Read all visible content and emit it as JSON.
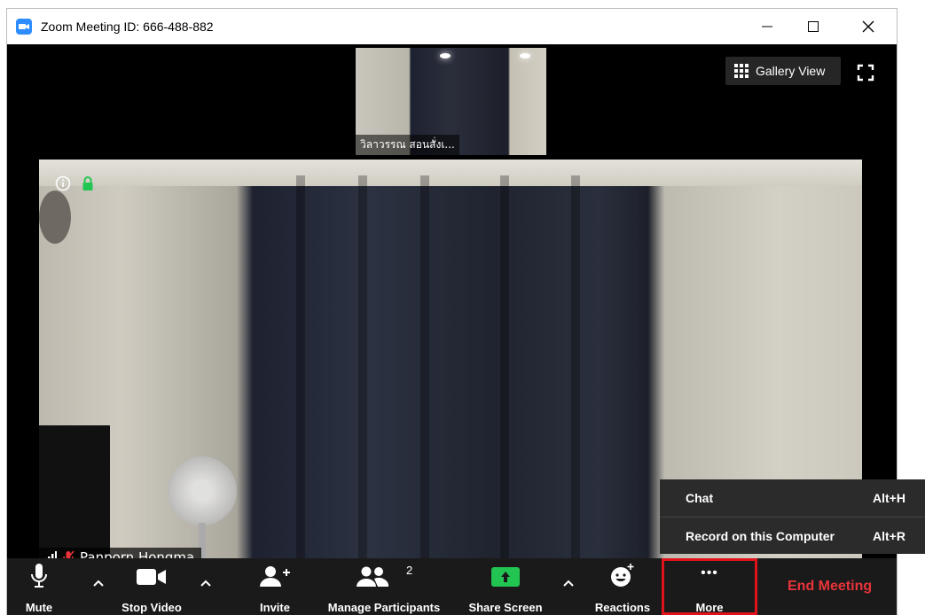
{
  "window": {
    "title": "Zoom Meeting ID: 666-488-882",
    "controls": {
      "minimize": "—",
      "maximize": "☐",
      "close": "✕"
    }
  },
  "thumbnail": {
    "participant_name": "วิลาวรรณ สอนสั่งเ..."
  },
  "view": {
    "gallery_label": "Gallery View"
  },
  "main_video": {
    "participant_name": "Panporn Hongma"
  },
  "toolbar": {
    "mute": "Mute",
    "stop_video": "Stop Video",
    "invite": "Invite",
    "manage_participants": "Manage Participants",
    "participant_count": "2",
    "share_screen": "Share Screen",
    "reactions": "Reactions",
    "more": "More",
    "more_dots": "•••",
    "end_meeting": "End Meeting",
    "caret": "^"
  },
  "more_menu": {
    "items": [
      {
        "label": "Chat",
        "shortcut": "Alt+H"
      },
      {
        "label": "Record on this Computer",
        "shortcut": "Alt+R"
      }
    ]
  },
  "colors": {
    "accent_blue": "#2d8cff",
    "share_green": "#23c552",
    "end_red": "#e8343a",
    "highlight_red": "#e0131b",
    "toolbar_bg": "#1a1a1a",
    "encryption_green": "#23c552"
  },
  "icons": [
    "zoom-logo-icon",
    "minimize-icon",
    "maximize-icon",
    "close-icon",
    "gallery-grid-icon",
    "fullscreen-icon",
    "info-icon",
    "lock-icon",
    "signal-icon",
    "mic-muted-icon",
    "mic-icon",
    "video-camera-icon",
    "add-person-icon",
    "participants-icon",
    "share-arrow-icon",
    "reactions-icon",
    "caret-up-icon"
  ]
}
